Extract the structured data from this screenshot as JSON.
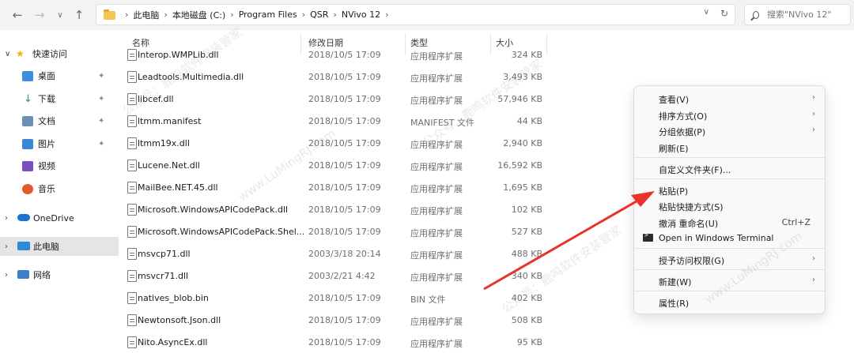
{
  "nav": {
    "back_icon": "←",
    "forward_icon": "→",
    "up_arrow_icon": "∨",
    "parent_icon": "↑"
  },
  "address": {
    "crumbs": [
      "此电脑",
      "本地磁盘 (C:)",
      "Program Files",
      "QSR",
      "NVivo 12"
    ],
    "separator": "›",
    "dropdown_icon": "∨",
    "refresh_icon": "↻"
  },
  "search": {
    "placeholder": "搜索\"NVivo 12\""
  },
  "sidebar": {
    "items": [
      {
        "label": "快速访问",
        "chev": "∨"
      },
      {
        "label": "桌面",
        "pin": "📌"
      },
      {
        "label": "下载",
        "pin": "📌"
      },
      {
        "label": "文档",
        "pin": "📌"
      },
      {
        "label": "图片",
        "pin": "📌"
      },
      {
        "label": "视频"
      },
      {
        "label": "音乐"
      },
      {
        "label": "OneDrive",
        "chev": "›"
      },
      {
        "label": "此电脑",
        "chev": "›"
      },
      {
        "label": "网络",
        "chev": "›"
      }
    ]
  },
  "columns": {
    "name": "名称",
    "date": "修改日期",
    "type": "类型",
    "size": "大小"
  },
  "files": [
    {
      "name": "Interop.WMPLib.dll",
      "date": "2018/10/5 17:09",
      "type": "应用程序扩展",
      "size": "324 KB"
    },
    {
      "name": "Leadtools.Multimedia.dll",
      "date": "2018/10/5 17:09",
      "type": "应用程序扩展",
      "size": "3,493 KB"
    },
    {
      "name": "libcef.dll",
      "date": "2018/10/5 17:09",
      "type": "应用程序扩展",
      "size": "57,946 KB"
    },
    {
      "name": "ltmm.manifest",
      "date": "2018/10/5 17:09",
      "type": "MANIFEST 文件",
      "size": "44 KB"
    },
    {
      "name": "ltmm19x.dll",
      "date": "2018/10/5 17:09",
      "type": "应用程序扩展",
      "size": "2,940 KB"
    },
    {
      "name": "Lucene.Net.dll",
      "date": "2018/10/5 17:09",
      "type": "应用程序扩展",
      "size": "16,592 KB"
    },
    {
      "name": "MailBee.NET.45.dll",
      "date": "2018/10/5 17:09",
      "type": "应用程序扩展",
      "size": "1,695 KB"
    },
    {
      "name": "Microsoft.WindowsAPICodePack.dll",
      "date": "2018/10/5 17:09",
      "type": "应用程序扩展",
      "size": "102 KB"
    },
    {
      "name": "Microsoft.WindowsAPICodePack.Shel...",
      "date": "2018/10/5 17:09",
      "type": "应用程序扩展",
      "size": "527 KB"
    },
    {
      "name": "msvcp71.dll",
      "date": "2003/3/18 20:14",
      "type": "应用程序扩展",
      "size": "488 KB"
    },
    {
      "name": "msvcr71.dll",
      "date": "2003/2/21 4:42",
      "type": "应用程序扩展",
      "size": "340 KB"
    },
    {
      "name": "natives_blob.bin",
      "date": "2018/10/5 17:09",
      "type": "BIN 文件",
      "size": "402 KB"
    },
    {
      "name": "Newtonsoft.Json.dll",
      "date": "2018/10/5 17:09",
      "type": "应用程序扩展",
      "size": "508 KB"
    },
    {
      "name": "Nito.AsyncEx.dll",
      "date": "2018/10/5 17:09",
      "type": "应用程序扩展",
      "size": "95 KB"
    }
  ],
  "context_menu": {
    "items": [
      {
        "label": "查看(V)",
        "submenu": "›"
      },
      {
        "label": "排序方式(O)",
        "submenu": "›"
      },
      {
        "label": "分组依据(P)",
        "submenu": "›"
      },
      {
        "label": "刷新(E)"
      },
      {
        "label": "自定义文件夹(F)..."
      },
      {
        "label": "粘贴(P)"
      },
      {
        "label": "粘贴快捷方式(S)"
      },
      {
        "label": "撤消 重命名(U)",
        "shortcut": "Ctrl+Z"
      },
      {
        "label": "Open in Windows Terminal"
      },
      {
        "label": "授予访问权限(G)",
        "submenu": "›"
      },
      {
        "label": "新建(W)",
        "submenu": "›"
      },
      {
        "label": "属性(R)"
      }
    ]
  },
  "watermark": {
    "text": "公众号：鹿鸣软件安装管家",
    "text2": "www.LuMingRJ.com"
  },
  "colors": {
    "arrow": "#e8322a",
    "accent": "#0067c0"
  }
}
